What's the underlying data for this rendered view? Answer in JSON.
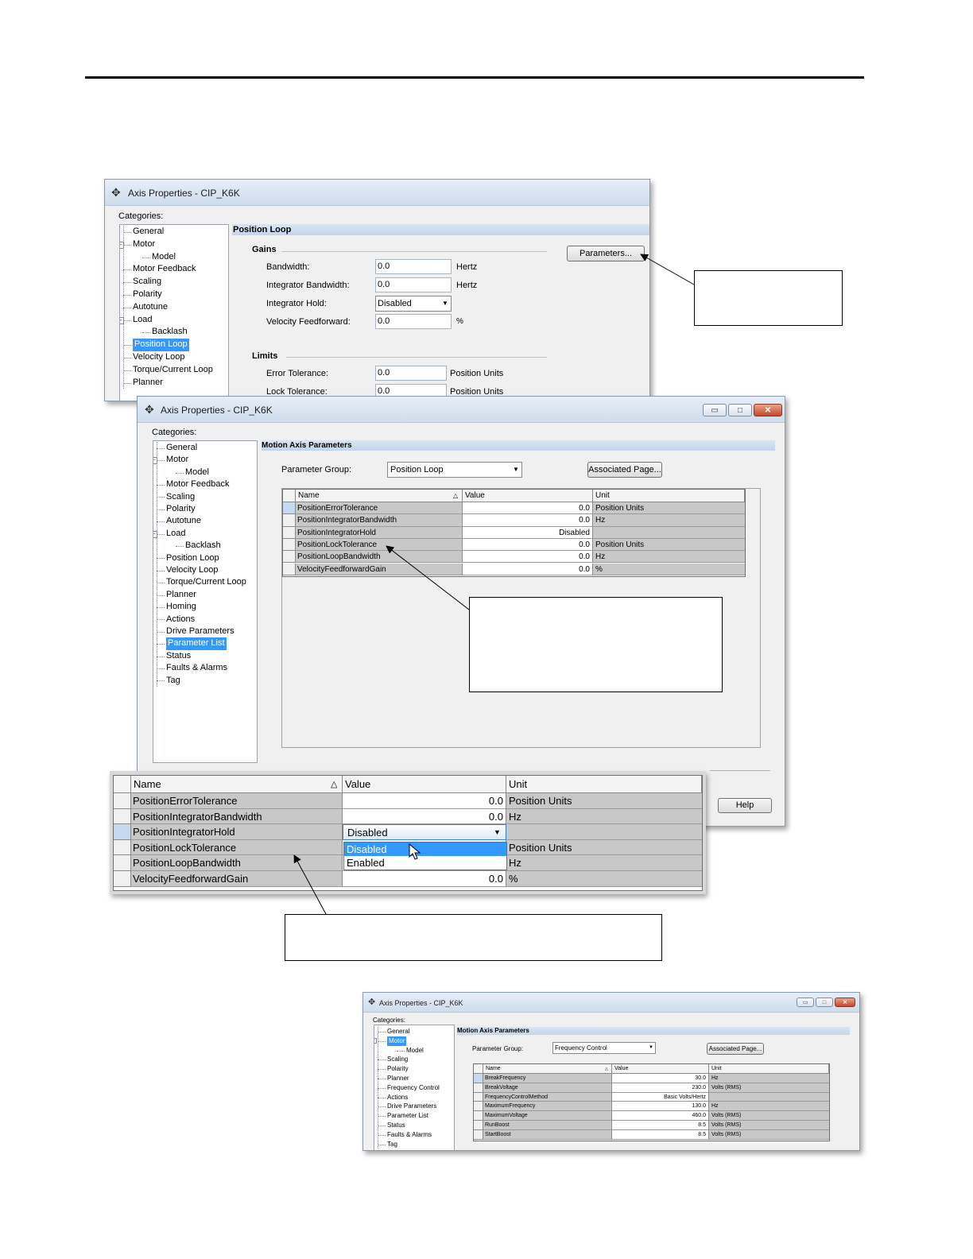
{
  "window1": {
    "title": "Axis Properties - CIP_K6K",
    "categories_label": "Categories:",
    "tree": [
      "General",
      "Motor",
      "Model",
      "Motor Feedback",
      "Scaling",
      "Polarity",
      "Autotune",
      "Load",
      "Backlash",
      "Position Loop",
      "Velocity Loop",
      "Torque/Current Loop",
      "Planner"
    ],
    "section_title": "Position Loop",
    "gains_label": "Gains",
    "parameters_button": "Parameters...",
    "bandwidth_label": "Bandwidth:",
    "bandwidth_value": "0.0",
    "bandwidth_unit": "Hertz",
    "integrator_bandwidth_label": "Integrator Bandwidth:",
    "integrator_bandwidth_value": "0.0",
    "integrator_bandwidth_unit": "Hertz",
    "integrator_hold_label": "Integrator Hold:",
    "integrator_hold_value": "Disabled",
    "velocity_ff_label": "Velocity Feedforward:",
    "velocity_ff_value": "0.0",
    "velocity_ff_unit": "%",
    "limits_label": "Limits",
    "error_tolerance_label": "Error Tolerance:",
    "error_tolerance_value": "0.0",
    "error_tolerance_unit": "Position Units",
    "lock_tolerance_label": "Lock Tolerance:",
    "lock_tolerance_value": "0.0",
    "lock_tolerance_unit": "Position Units"
  },
  "window2": {
    "title": "Axis Properties - CIP_K6K",
    "categories_label": "Categories:",
    "tree": [
      "General",
      "Motor",
      "Model",
      "Motor Feedback",
      "Scaling",
      "Polarity",
      "Autotune",
      "Load",
      "Backlash",
      "Position Loop",
      "Velocity Loop",
      "Torque/Current Loop",
      "Planner",
      "Homing",
      "Actions",
      "Drive Parameters",
      "Parameter List",
      "Status",
      "Faults & Alarms",
      "Tag"
    ],
    "section_title": "Motion Axis Parameters",
    "parameter_group_label": "Parameter Group:",
    "parameter_group_value": "Position Loop",
    "associated_page_button": "Associated Page...",
    "help_button": "Help",
    "columns": [
      "Name",
      "Value",
      "Unit"
    ],
    "rows": [
      {
        "name": "PositionErrorTolerance",
        "value": "0.0",
        "unit": "Position Units"
      },
      {
        "name": "PositionIntegratorBandwidth",
        "value": "0.0",
        "unit": "Hz"
      },
      {
        "name": "PositionIntegratorHold",
        "value": "Disabled",
        "unit": ""
      },
      {
        "name": "PositionLockTolerance",
        "value": "0.0",
        "unit": "Position Units"
      },
      {
        "name": "PositionLoopBandwidth",
        "value": "0.0",
        "unit": "Hz"
      },
      {
        "name": "VelocityFeedforwardGain",
        "value": "0.0",
        "unit": "%"
      }
    ]
  },
  "zoom_grid": {
    "columns": [
      "Name",
      "Value",
      "Unit"
    ],
    "rows": [
      {
        "name": "PositionErrorTolerance",
        "value": "0.0",
        "unit": "Position Units"
      },
      {
        "name": "PositionIntegratorBandwidth",
        "value": "0.0",
        "unit": "Hz"
      },
      {
        "name": "PositionIntegratorHold",
        "value": "Disabled",
        "unit": ""
      },
      {
        "name": "PositionLockTolerance",
        "value": "",
        "unit": "Position Units"
      },
      {
        "name": "PositionLoopBandwidth",
        "value": "",
        "unit": "Hz"
      },
      {
        "name": "VelocityFeedforwardGain",
        "value": "0.0",
        "unit": "%"
      }
    ],
    "dropdown_options": [
      "Disabled",
      "Enabled"
    ]
  },
  "window3": {
    "title": "Axis Properties - CIP_K6K",
    "categories_label": "Categories:",
    "tree": [
      "General",
      "Motor",
      "Model",
      "Scaling",
      "Polarity",
      "Planner",
      "Frequency Control",
      "Actions",
      "Drive Parameters",
      "Parameter List",
      "Status",
      "Faults & Alarms",
      "Tag"
    ],
    "section_title": "Motion Axis Parameters",
    "parameter_group_label": "Parameter Group:",
    "parameter_group_value": "Frequency Control",
    "associated_page_button": "Associated Page...",
    "columns": [
      "Name",
      "Value",
      "Unit"
    ],
    "rows": [
      {
        "name": "BreakFrequency",
        "value": "30.0",
        "unit": "Hz"
      },
      {
        "name": "BreakVoltage",
        "value": "230.0",
        "unit": "Volts (RMS)"
      },
      {
        "name": "FrequencyControlMethod",
        "value": "Basic Volts/Hertz",
        "unit": ""
      },
      {
        "name": "MaximumFrequency",
        "value": "130.0",
        "unit": "Hz"
      },
      {
        "name": "MaximumVoltage",
        "value": "460.0",
        "unit": "Volts (RMS)"
      },
      {
        "name": "RunBoost",
        "value": "8.5",
        "unit": "Volts (RMS)"
      },
      {
        "name": "StartBoost",
        "value": "8.5",
        "unit": "Volts (RMS)"
      }
    ]
  },
  "icons": [
    "axis-properties-icon",
    "dropdown-arrow-icon",
    "sort-arrow-icon",
    "mouse-cursor-icon",
    "minimize-icon",
    "maximize-icon",
    "close-icon"
  ]
}
